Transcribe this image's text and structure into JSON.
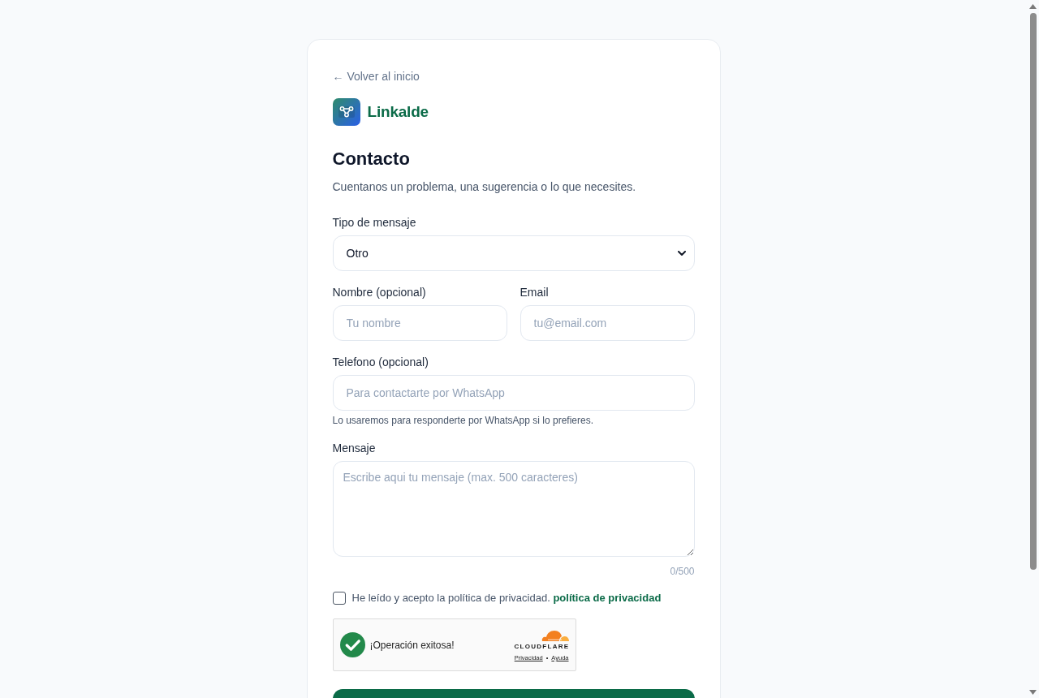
{
  "back_link": "← Volver al inicio",
  "brand": {
    "name": "Linkalde"
  },
  "title": "Contacto",
  "subtitle": "Cuentanos un problema, una sugerencia o lo que necesites.",
  "form": {
    "message_type": {
      "label": "Tipo de mensaje",
      "value": "Otro"
    },
    "name": {
      "label": "Nombre (opcional)",
      "placeholder": "Tu nombre"
    },
    "email": {
      "label": "Email",
      "placeholder": "tu@email.com"
    },
    "phone": {
      "label": "Telefono (opcional)",
      "placeholder": "Para contactarte por WhatsApp",
      "hint": "Lo usaremos para responderte por WhatsApp si lo prefieres."
    },
    "message": {
      "label": "Mensaje",
      "placeholder": "Escribe aqui tu mensaje (max. 500 caracteres)",
      "counter": "0/500"
    },
    "consent": {
      "text": "He leído y acepto la política de privacidad.",
      "link": "política de privacidad",
      "checked": false
    }
  },
  "captcha": {
    "verified": true,
    "message": "¡Operación exitosa!",
    "provider": "CLOUDFLARE",
    "links": [
      "Privacidad",
      "Ayuda"
    ],
    "separator": "•"
  }
}
